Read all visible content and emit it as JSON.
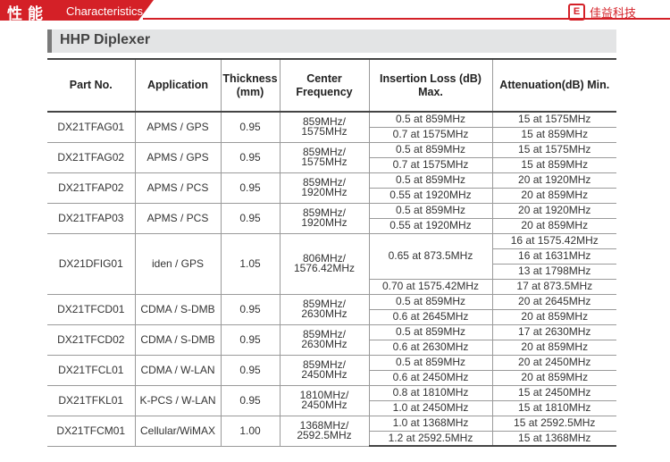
{
  "header": {
    "cn_title": "性能",
    "en_title": "Characteristics",
    "logo_mark": "E",
    "brand": "佳益科技"
  },
  "section": {
    "title": "HHP Diplexer"
  },
  "table": {
    "headers": {
      "part_no": "Part No.",
      "application": "Application",
      "thickness": "Thickness (mm)",
      "center_frequency": "Center Frequency",
      "insertion_loss": "Insertion Loss (dB) Max.",
      "attenuation": "Attenuation(dB) Min."
    },
    "rows": [
      {
        "part": "DX21TFAG01",
        "app": "APMS / GPS",
        "thick": "0.95",
        "cf": [
          "859MHz/",
          "1575MHz"
        ],
        "il": [
          "0.5 at 859MHz",
          "0.7 at 1575MHz"
        ],
        "att": [
          "15 at 1575MHz",
          "15 at 859MHz"
        ]
      },
      {
        "part": "DX21TFAG02",
        "app": "APMS / GPS",
        "thick": "0.95",
        "cf": [
          "859MHz/",
          "1575MHz"
        ],
        "il": [
          "0.5 at 859MHz",
          "0.7 at 1575MHz"
        ],
        "att": [
          "15 at 1575MHz",
          "15 at 859MHz"
        ]
      },
      {
        "part": "DX21TFAP02",
        "app": "APMS / PCS",
        "thick": "0.95",
        "cf": [
          "859MHz/",
          "1920MHz"
        ],
        "il": [
          "0.5 at 859MHz",
          "0.55 at 1920MHz"
        ],
        "att": [
          "20 at 1920MHz",
          "20 at 859MHz"
        ]
      },
      {
        "part": "DX21TFAP03",
        "app": "APMS / PCS",
        "thick": "0.95",
        "cf": [
          "859MHz/",
          "1920MHz"
        ],
        "il": [
          "0.5 at 859MHz",
          "0.55 at 1920MHz"
        ],
        "att": [
          "20 at 1920MHz",
          "20 at 859MHz"
        ]
      },
      {
        "part": "DX21DFIG01",
        "app": "iden / GPS",
        "thick": "1.05",
        "cf": [
          "806MHz/",
          "1576.42MHz"
        ],
        "il": [
          "0.65 at 873.5MHz",
          "0.70 at 1575.42MHz"
        ],
        "att": [
          "16 at 1575.42MHz",
          "16 at 1631MHz",
          "13 at 1798MHz",
          "17 at 873.5MHz"
        ]
      },
      {
        "part": "DX21TFCD01",
        "app": "CDMA / S-DMB",
        "thick": "0.95",
        "cf": [
          "859MHz/",
          "2630MHz"
        ],
        "il": [
          "0.5 at 859MHz",
          "0.6 at 2645MHz"
        ],
        "att": [
          "20 at 2645MHz",
          "20 at 859MHz"
        ]
      },
      {
        "part": "DX21TFCD02",
        "app": "CDMA / S-DMB",
        "thick": "0.95",
        "cf": [
          "859MHz/",
          "2630MHz"
        ],
        "il": [
          "0.5 at 859MHz",
          "0.6 at 2630MHz"
        ],
        "att": [
          "17 at 2630MHz",
          "20 at 859MHz"
        ]
      },
      {
        "part": "DX21TFCL01",
        "app": "CDMA / W-LAN",
        "thick": "0.95",
        "cf": [
          "859MHz/",
          "2450MHz"
        ],
        "il": [
          "0.5 at 859MHz",
          "0.6 at 2450MHz"
        ],
        "att": [
          "20 at 2450MHz",
          "20 at 859MHz"
        ]
      },
      {
        "part": "DX21TFKL01",
        "app": "K-PCS / W-LAN",
        "thick": "0.95",
        "cf": [
          "1810MHz/",
          "2450MHz"
        ],
        "il": [
          "0.8 at 1810MHz",
          "1.0 at 2450MHz"
        ],
        "att": [
          "15 at 2450MHz",
          "15 at 1810MHz"
        ]
      },
      {
        "part": "DX21TFCM01",
        "app": "Cellular/WiMAX",
        "thick": "1.00",
        "cf": [
          "1368MHz/",
          "2592.5MHz"
        ],
        "il": [
          "1.0 at 1368MHz",
          "1.2 at 2592.5MHz"
        ],
        "att": [
          "15 at 2592.5MHz",
          "15 at 1368MHz"
        ]
      }
    ]
  }
}
